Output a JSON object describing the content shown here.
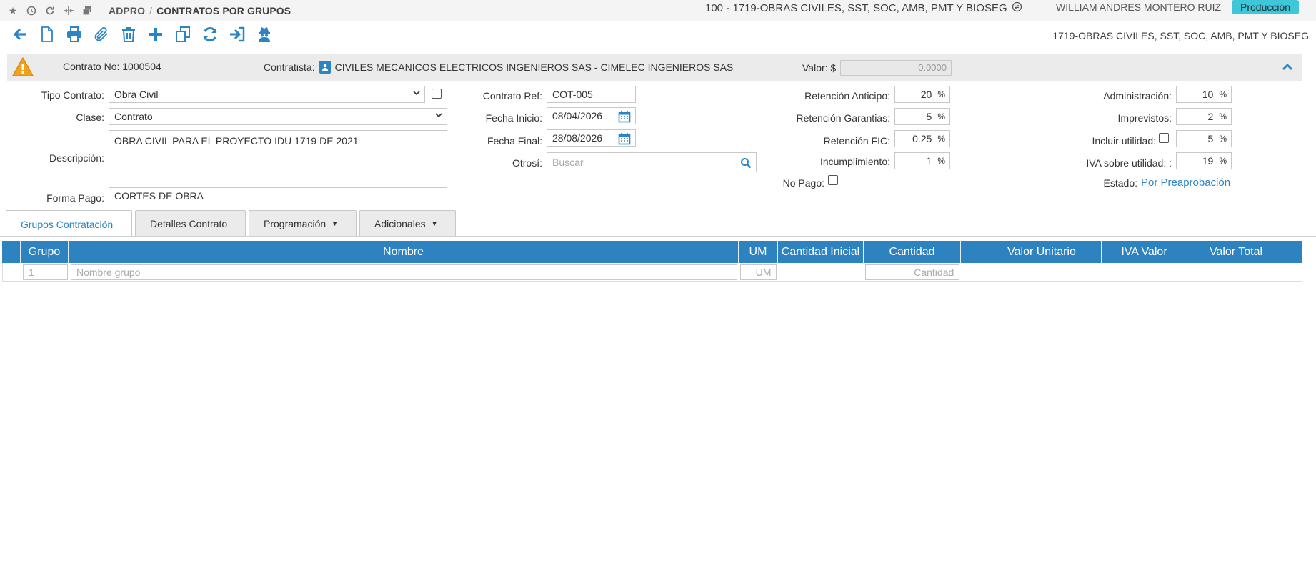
{
  "topbar": {
    "breadcrumb_app": "ADPRO",
    "breadcrumb_sep": "/",
    "breadcrumb_page": "CONTRATOS POR GRUPOS",
    "project": "100 - 1719-OBRAS CIVILES, SST, SOC, AMB, PMT Y BIOSEG",
    "user": "WILLIAM ANDRES MONTERO RUIZ",
    "environment": "Producción"
  },
  "toolbar": {
    "project_label": "1719-OBRAS CIVILES, SST, SOC, AMB, PMT Y BIOSEG",
    "accent_color": "#2b84c3"
  },
  "contract_header": {
    "contract_no_label": "Contrato No:",
    "contract_no": "1000504",
    "contratista_label": "Contratista:",
    "contratista": "CIVILES MECANICOS ELECTRICOS INGENIEROS SAS - CIMELEC INGENIEROS SAS",
    "valor_label": "Valor: $",
    "valor": "0.0000"
  },
  "form": {
    "tipo_contrato_label": "Tipo Contrato:",
    "tipo_contrato": "Obra Civil",
    "clase_label": "Clase:",
    "clase": "Contrato",
    "descripcion_label": "Descripción:",
    "descripcion": "OBRA CIVIL PARA EL PROYECTO IDU 1719 DE 2021",
    "forma_pago_label": "Forma Pago:",
    "forma_pago": "CORTES DE OBRA",
    "contrato_ref_label": "Contrato Ref:",
    "contrato_ref": "COT-005",
    "fecha_inicio_label": "Fecha Inicio:",
    "fecha_inicio": "08/04/2026",
    "fecha_final_label": "Fecha Final:",
    "fecha_final": "28/08/2026",
    "otrosi_label": "Otrosí:",
    "otrosi_placeholder": "Buscar",
    "retencion_anticipo_label": "Retención Anticipo:",
    "retencion_anticipo": "20",
    "retencion_garantias_label": "Retención Garantias:",
    "retencion_garantias": "5",
    "retencion_fic_label": "Retención FIC:",
    "retencion_fic": "0.25",
    "incumplimiento_label": "Incumplimiento:",
    "incumplimiento": "1",
    "no_pago_label": "No Pago:",
    "administracion_label": "Administración:",
    "administracion": "10",
    "imprevistos_label": "Imprevistos:",
    "imprevistos": "2",
    "incluir_utilidad_label": "Incluir utilidad:",
    "incluir_utilidad": "5",
    "iva_utilidad_label": "IVA sobre utilidad: :",
    "iva_utilidad": "19",
    "estado_label": "Estado:",
    "estado": "Por Preaprobación",
    "pct": "%"
  },
  "tabs": [
    {
      "label": "Grupos Contratación"
    },
    {
      "label": "Detalles Contrato"
    },
    {
      "label": "Programación"
    },
    {
      "label": "Adicionales"
    }
  ],
  "grid": {
    "headers": [
      "Grupo",
      "Nombre",
      "UM",
      "Cantidad Inicial",
      "Cantidad",
      "Valor Unitario",
      "IVA Valor",
      "Valor Total"
    ],
    "row": {
      "grupo_placeholder": "1",
      "nombre_placeholder": "Nombre grupo",
      "um_placeholder": "UM",
      "cantidad_placeholder": "Cantidad"
    }
  }
}
